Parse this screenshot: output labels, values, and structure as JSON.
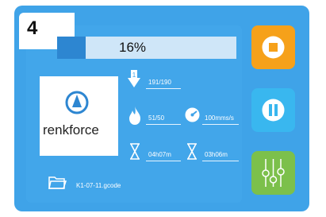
{
  "job": {
    "number": "4"
  },
  "progress": {
    "label": "16%",
    "value": 0.16
  },
  "brand": {
    "name": "renkforce"
  },
  "layer": {
    "text": "191/190"
  },
  "temperature": {
    "text": "51/50"
  },
  "speed": {
    "text": "100mms/s"
  },
  "elapsed": {
    "text": "04h07m"
  },
  "remaining": {
    "text": "03h06m"
  },
  "file": {
    "name": "K1-07-11.gcode"
  },
  "colors": {
    "background": "#3fa3e8",
    "stop": "#f6a11a",
    "pause": "#39b7ef",
    "settings": "#7cc04b"
  },
  "icons": {
    "layer": "layer-down-icon",
    "temperature": "flame-icon",
    "speed": "speed-gauge-icon",
    "elapsed": "hourglass-icon",
    "remaining": "hourglass-icon",
    "file": "folder-icon",
    "stop": "stop-icon",
    "pause": "pause-icon",
    "settings": "sliders-icon"
  }
}
